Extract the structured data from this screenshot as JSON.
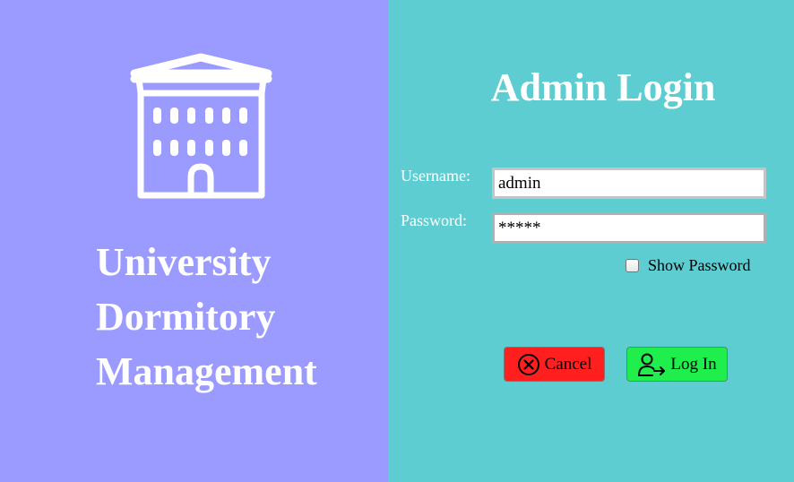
{
  "branding": {
    "logo_icon": "university-building-icon",
    "title_lines": [
      "University",
      "Dormitory",
      "Management"
    ]
  },
  "login": {
    "title": "Admin Login",
    "username_label": "Username:",
    "username_value": "admin",
    "password_label": "Password:",
    "password_value": "*****",
    "show_password_label": "Show Password",
    "show_password_checked": false,
    "cancel_label": "Cancel",
    "cancel_icon": "close-circle-icon",
    "login_label": "Log In",
    "login_icon": "user-login-icon"
  },
  "colors": {
    "left_panel": "#9a9aff",
    "right_panel": "#5ecdd2",
    "cancel_button": "#ff1f1f",
    "login_button": "#1fee4d",
    "text_light": "#ffffff"
  }
}
